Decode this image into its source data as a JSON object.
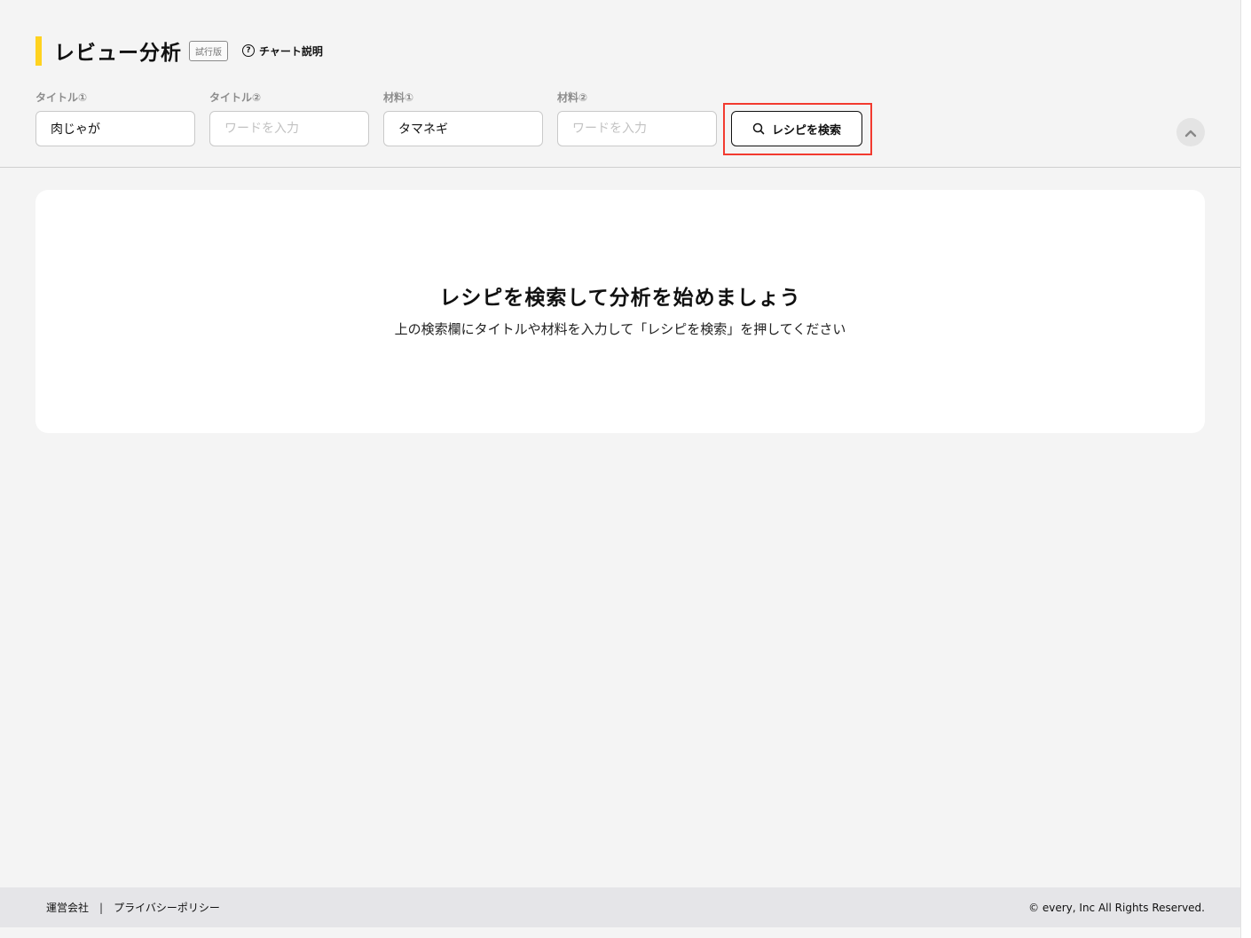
{
  "header": {
    "title": "レビュー分析",
    "badge": "試行版",
    "help_label": "チャート説明",
    "help_icon": "question-circle-icon"
  },
  "search": {
    "fields": [
      {
        "label": "タイトル①",
        "value": "肉じゃが",
        "placeholder": ""
      },
      {
        "label": "タイトル②",
        "value": "",
        "placeholder": "ワードを入力"
      },
      {
        "label": "材料①",
        "value": "タマネギ",
        "placeholder": ""
      },
      {
        "label": "材料②",
        "value": "",
        "placeholder": "ワードを入力"
      }
    ],
    "button_label": "レシピを検索",
    "button_icon": "search-icon",
    "highlight_color": "#f23a2f",
    "collapse_icon": "chevron-up-icon"
  },
  "main": {
    "empty_title": "レシピを検索して分析を始めましょう",
    "empty_description": "上の検索欄にタイトルや材料を入力して「レシピを検索」を押してください"
  },
  "footer": {
    "links": [
      "運営会社",
      "プライバシーポリシー"
    ],
    "separator": "|",
    "copyright": "© every, Inc All Rights Reserved."
  },
  "colors": {
    "accent": "#ffd21f",
    "background": "#f4f4f4",
    "card": "#ffffff"
  }
}
